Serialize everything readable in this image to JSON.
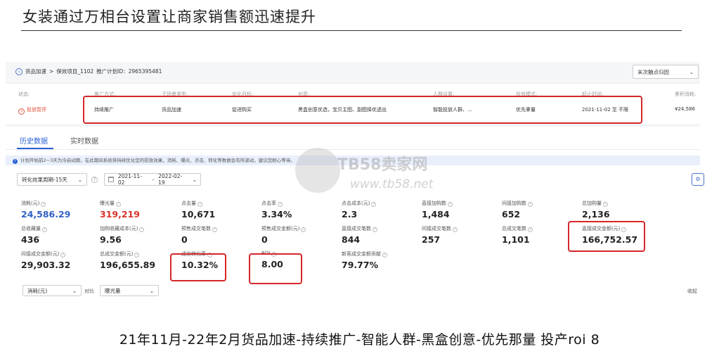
{
  "slide_title": "女装通过万相台设置让商家销售额迅速提升",
  "caption": "21年11月-22年2月货品加速-持续推广-智能人群-黑盒创意-优先那量 投产roi 8",
  "breadcrumb": {
    "back_icon": "back-arrow-icon",
    "root": "货品加速",
    "sep": ">",
    "project": "保效项目_1102",
    "plan_id": "推广计划ID：2965395481"
  },
  "attribution_select": {
    "value": "末次触点归因"
  },
  "plan_info": [
    {
      "label": "状态:",
      "value": "投放暂停"
    },
    {
      "label": "推广方式:",
      "value": "持续推广"
    },
    {
      "label": "子场景类型:",
      "value": "货品加速"
    },
    {
      "label": "优化目标:",
      "value": "促进购买"
    },
    {
      "label": "创意:",
      "value": "黑盒创意优选，宝贝主图、副图择优透出"
    },
    {
      "label": "人群设置:",
      "value": "智能投放人群、..."
    },
    {
      "label": "投放模式:",
      "value": "优先拿量"
    },
    {
      "label": "起止时间:",
      "value": "2021-11-02 至 不限"
    },
    {
      "label": "累积消耗:",
      "value": "¥24,586"
    }
  ],
  "tabs": [
    {
      "label": "历史数据",
      "active": true
    },
    {
      "label": "实时数据",
      "active": false
    }
  ],
  "notice": "计划开始前2~3天为冷启动期，在此期间系统将持续优化您的投放效果，消耗、曝光、点击、转化等数据会有所波动，建议您耐心等待。",
  "period_select": {
    "value": "转化效果周期-15天"
  },
  "date_range": {
    "start": "2021-11-02",
    "sep": "-",
    "end": "2022-02-19"
  },
  "metrics": [
    {
      "label": "消耗(元)",
      "value": "24,586.29",
      "color": "#3162c4"
    },
    {
      "label": "曝光量",
      "value": "319,219",
      "color": "#d9322b"
    },
    {
      "label": "点击量",
      "value": "10,671"
    },
    {
      "label": "点击率",
      "value": "3.34%"
    },
    {
      "label": "点击成本(元)",
      "value": "2.3"
    },
    {
      "label": "直接加购数",
      "value": "1,484"
    },
    {
      "label": "间接加购数",
      "value": "652"
    },
    {
      "label": "总加购量",
      "value": "2,136"
    },
    {
      "label": "总收藏量",
      "value": "436"
    },
    {
      "label": "加购收藏成本(元)",
      "value": "9.56"
    },
    {
      "label": "预售成交笔数",
      "value": "0"
    },
    {
      "label": "预售成交金额(元)",
      "value": "0"
    },
    {
      "label": "直接成交笔数",
      "value": "844"
    },
    {
      "label": "间接成交笔数",
      "value": "257"
    },
    {
      "label": "总成交笔数",
      "value": "1,101"
    },
    {
      "label": "直接成交金额(元)",
      "value": "166,752.57"
    },
    {
      "label": "间接成交金额(元)",
      "value": "29,903.32"
    },
    {
      "label": "总成交金额(元)",
      "value": "196,655.89"
    },
    {
      "label": "成交转化率",
      "value": "10.32%"
    },
    {
      "label": "ROI",
      "value": "8.00"
    },
    {
      "label": "新客成交金额贡献",
      "value": "79.77%"
    }
  ],
  "compare": {
    "left": "消耗(元)",
    "vs": "对比",
    "right": "曝光量",
    "collapse": "收起"
  },
  "watermark": {
    "line1": "TB58卖家网",
    "line2": "www.tb58.net"
  }
}
